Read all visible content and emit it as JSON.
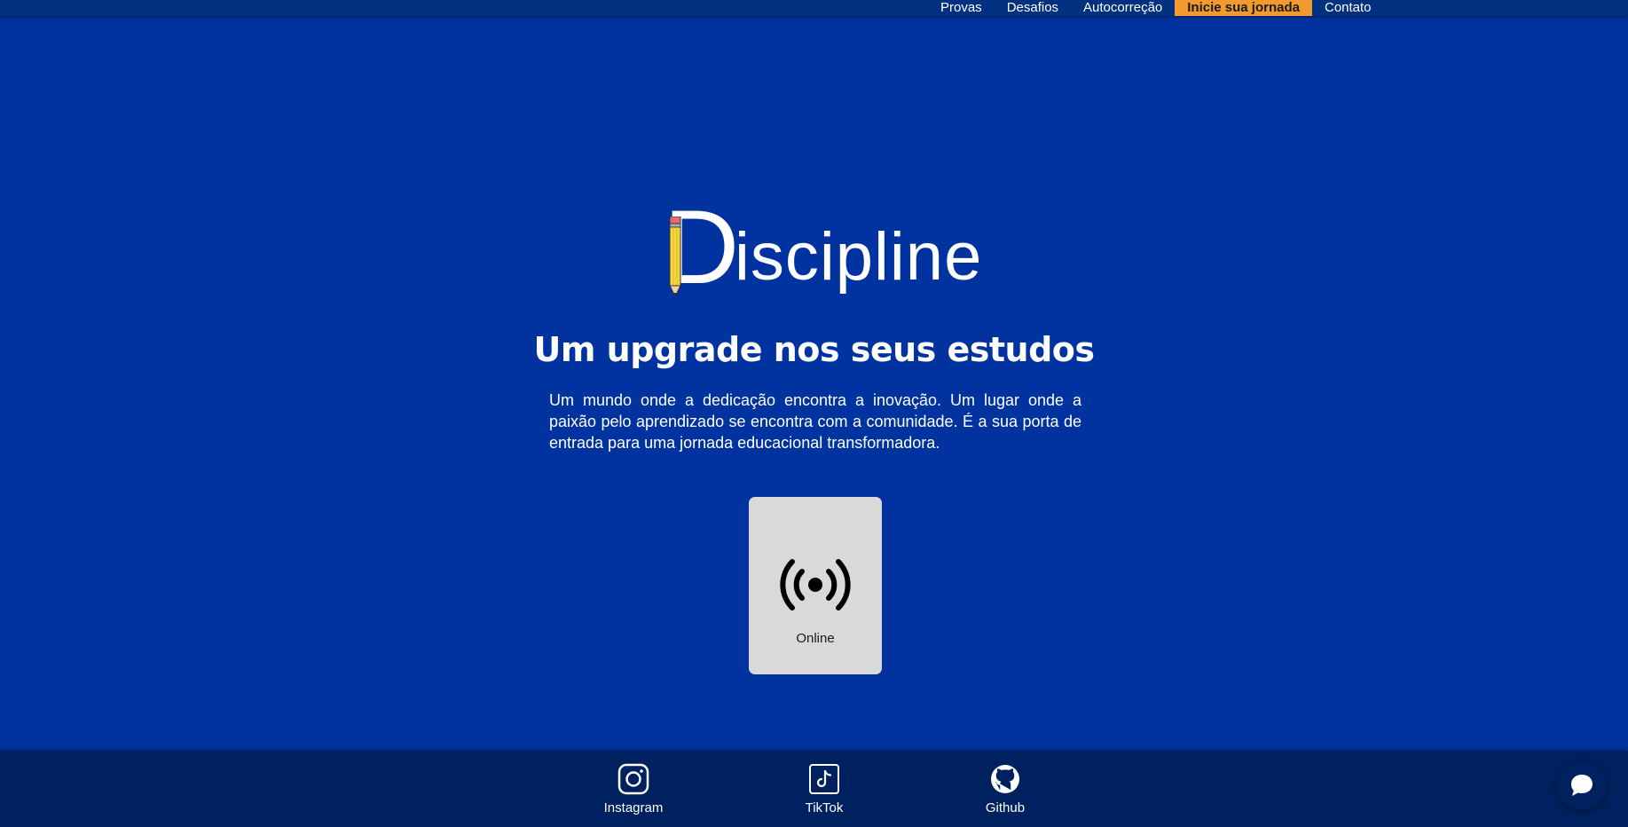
{
  "nav": {
    "items": [
      {
        "label": "Provas"
      },
      {
        "label": "Desafios"
      },
      {
        "label": "Autocorreção"
      },
      {
        "label": "Inicie sua jornada",
        "highlight": true
      },
      {
        "label": "Contato"
      }
    ]
  },
  "hero": {
    "logo_initial": "D",
    "logo_rest": "iscipline",
    "headline": "Um upgrade nos seus estudos",
    "intro": "Um mundo onde a dedicação encontra a inovação. Um lugar onde a paixão pelo aprendizado se encontra com a comunidade. É a sua porta de entrada para uma jornada educacional transformadora."
  },
  "card": {
    "icon": "broadcast-signal-icon",
    "label": "Online"
  },
  "footer": {
    "links": [
      {
        "label": "Instagram",
        "icon": "instagram-icon"
      },
      {
        "label": "TikTok",
        "icon": "tiktok-icon"
      },
      {
        "label": "Github",
        "icon": "github-icon"
      }
    ]
  },
  "colors": {
    "background": "#0033a0",
    "topbar": "#00307f",
    "footer": "#00215f",
    "cta": "#f29a2e",
    "card": "#d9d9d9"
  }
}
